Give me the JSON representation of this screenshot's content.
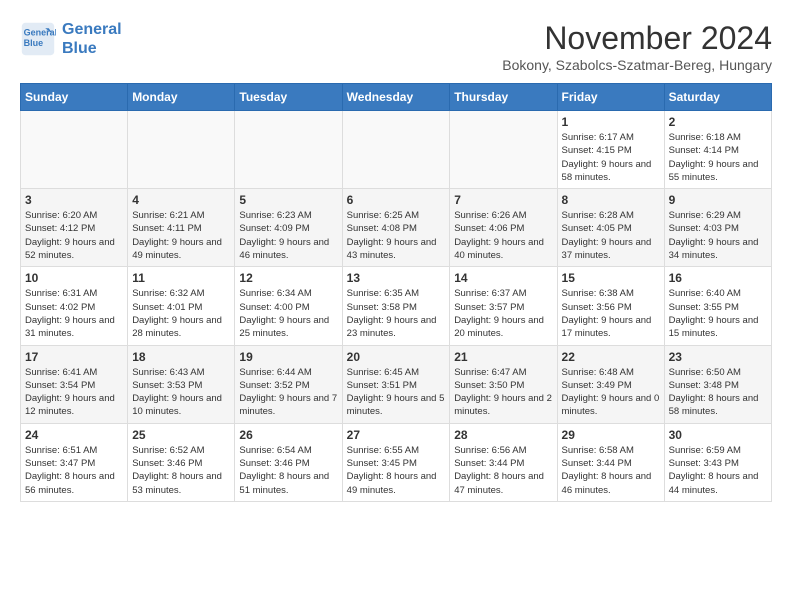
{
  "header": {
    "logo_line1": "General",
    "logo_line2": "Blue",
    "month": "November 2024",
    "location": "Bokony, Szabolcs-Szatmar-Bereg, Hungary"
  },
  "weekdays": [
    "Sunday",
    "Monday",
    "Tuesday",
    "Wednesday",
    "Thursday",
    "Friday",
    "Saturday"
  ],
  "weeks": [
    [
      {
        "day": "",
        "detail": ""
      },
      {
        "day": "",
        "detail": ""
      },
      {
        "day": "",
        "detail": ""
      },
      {
        "day": "",
        "detail": ""
      },
      {
        "day": "",
        "detail": ""
      },
      {
        "day": "1",
        "detail": "Sunrise: 6:17 AM\nSunset: 4:15 PM\nDaylight: 9 hours and 58 minutes."
      },
      {
        "day": "2",
        "detail": "Sunrise: 6:18 AM\nSunset: 4:14 PM\nDaylight: 9 hours and 55 minutes."
      }
    ],
    [
      {
        "day": "3",
        "detail": "Sunrise: 6:20 AM\nSunset: 4:12 PM\nDaylight: 9 hours and 52 minutes."
      },
      {
        "day": "4",
        "detail": "Sunrise: 6:21 AM\nSunset: 4:11 PM\nDaylight: 9 hours and 49 minutes."
      },
      {
        "day": "5",
        "detail": "Sunrise: 6:23 AM\nSunset: 4:09 PM\nDaylight: 9 hours and 46 minutes."
      },
      {
        "day": "6",
        "detail": "Sunrise: 6:25 AM\nSunset: 4:08 PM\nDaylight: 9 hours and 43 minutes."
      },
      {
        "day": "7",
        "detail": "Sunrise: 6:26 AM\nSunset: 4:06 PM\nDaylight: 9 hours and 40 minutes."
      },
      {
        "day": "8",
        "detail": "Sunrise: 6:28 AM\nSunset: 4:05 PM\nDaylight: 9 hours and 37 minutes."
      },
      {
        "day": "9",
        "detail": "Sunrise: 6:29 AM\nSunset: 4:03 PM\nDaylight: 9 hours and 34 minutes."
      }
    ],
    [
      {
        "day": "10",
        "detail": "Sunrise: 6:31 AM\nSunset: 4:02 PM\nDaylight: 9 hours and 31 minutes."
      },
      {
        "day": "11",
        "detail": "Sunrise: 6:32 AM\nSunset: 4:01 PM\nDaylight: 9 hours and 28 minutes."
      },
      {
        "day": "12",
        "detail": "Sunrise: 6:34 AM\nSunset: 4:00 PM\nDaylight: 9 hours and 25 minutes."
      },
      {
        "day": "13",
        "detail": "Sunrise: 6:35 AM\nSunset: 3:58 PM\nDaylight: 9 hours and 23 minutes."
      },
      {
        "day": "14",
        "detail": "Sunrise: 6:37 AM\nSunset: 3:57 PM\nDaylight: 9 hours and 20 minutes."
      },
      {
        "day": "15",
        "detail": "Sunrise: 6:38 AM\nSunset: 3:56 PM\nDaylight: 9 hours and 17 minutes."
      },
      {
        "day": "16",
        "detail": "Sunrise: 6:40 AM\nSunset: 3:55 PM\nDaylight: 9 hours and 15 minutes."
      }
    ],
    [
      {
        "day": "17",
        "detail": "Sunrise: 6:41 AM\nSunset: 3:54 PM\nDaylight: 9 hours and 12 minutes."
      },
      {
        "day": "18",
        "detail": "Sunrise: 6:43 AM\nSunset: 3:53 PM\nDaylight: 9 hours and 10 minutes."
      },
      {
        "day": "19",
        "detail": "Sunrise: 6:44 AM\nSunset: 3:52 PM\nDaylight: 9 hours and 7 minutes."
      },
      {
        "day": "20",
        "detail": "Sunrise: 6:45 AM\nSunset: 3:51 PM\nDaylight: 9 hours and 5 minutes."
      },
      {
        "day": "21",
        "detail": "Sunrise: 6:47 AM\nSunset: 3:50 PM\nDaylight: 9 hours and 2 minutes."
      },
      {
        "day": "22",
        "detail": "Sunrise: 6:48 AM\nSunset: 3:49 PM\nDaylight: 9 hours and 0 minutes."
      },
      {
        "day": "23",
        "detail": "Sunrise: 6:50 AM\nSunset: 3:48 PM\nDaylight: 8 hours and 58 minutes."
      }
    ],
    [
      {
        "day": "24",
        "detail": "Sunrise: 6:51 AM\nSunset: 3:47 PM\nDaylight: 8 hours and 56 minutes."
      },
      {
        "day": "25",
        "detail": "Sunrise: 6:52 AM\nSunset: 3:46 PM\nDaylight: 8 hours and 53 minutes."
      },
      {
        "day": "26",
        "detail": "Sunrise: 6:54 AM\nSunset: 3:46 PM\nDaylight: 8 hours and 51 minutes."
      },
      {
        "day": "27",
        "detail": "Sunrise: 6:55 AM\nSunset: 3:45 PM\nDaylight: 8 hours and 49 minutes."
      },
      {
        "day": "28",
        "detail": "Sunrise: 6:56 AM\nSunset: 3:44 PM\nDaylight: 8 hours and 47 minutes."
      },
      {
        "day": "29",
        "detail": "Sunrise: 6:58 AM\nSunset: 3:44 PM\nDaylight: 8 hours and 46 minutes."
      },
      {
        "day": "30",
        "detail": "Sunrise: 6:59 AM\nSunset: 3:43 PM\nDaylight: 8 hours and 44 minutes."
      }
    ]
  ]
}
